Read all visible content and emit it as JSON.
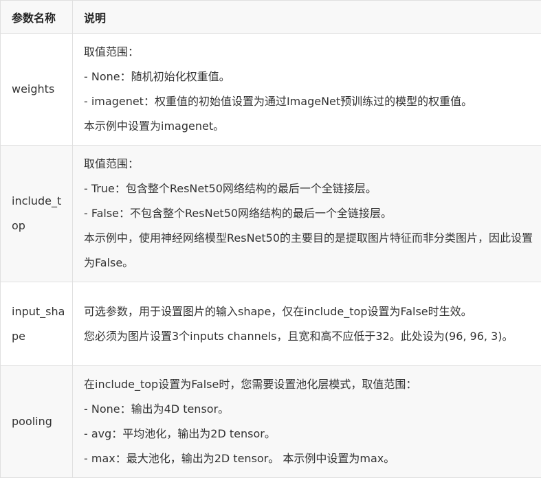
{
  "header": {
    "col_name": "参数名称",
    "col_desc": "说明"
  },
  "rows": [
    {
      "name": "weights",
      "lines": [
        "取值范围：",
        "- None：随机初始化权重值。",
        "- imagenet：权重值的初始值设置为通过ImageNet预训练过的模型的权重值。",
        "本示例中设置为imagenet。"
      ]
    },
    {
      "name": "include_top",
      "lines": [
        "取值范围：",
        "- True：包含整个ResNet50网络结构的最后一个全链接层。",
        "- False：不包含整个ResNet50网络结构的最后一个全链接层。",
        "本示例中，使用神经网络模型ResNet50的主要目的是提取图片特征而非分类图片，因此设置为False。"
      ]
    },
    {
      "name": "input_shape",
      "lines": [
        "可选参数，用于设置图片的输入shape，仅在include_top设置为False时生效。",
        "您必须为图片设置3个inputs channels，且宽和高不应低于32。此处设为(96, 96, 3)。"
      ]
    },
    {
      "name": "pooling",
      "lines": [
        "在include_top设置为False时，您需要设置池化层模式，取值范围：",
        "- None：输出为4D tensor。",
        "- avg：平均池化，输出为2D tensor。",
        "- max：最大池化，输出为2D tensor。 本示例中设置为max。"
      ]
    }
  ]
}
